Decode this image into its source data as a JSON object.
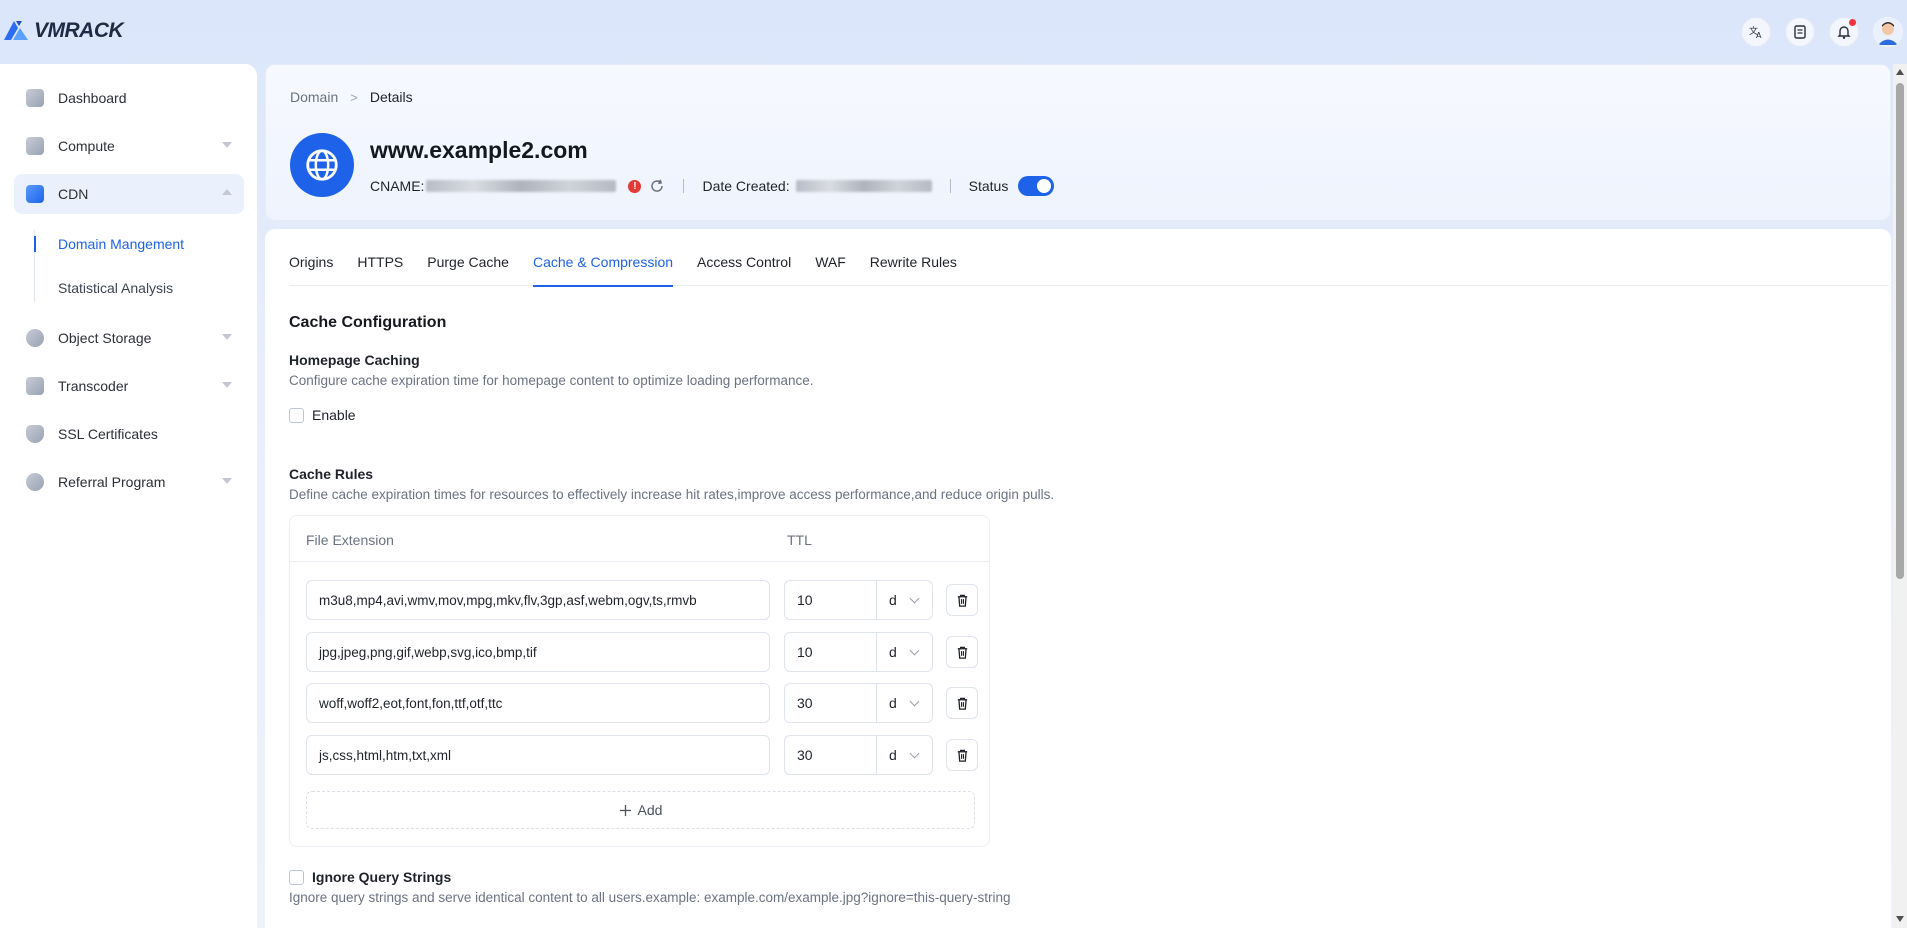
{
  "app": {
    "logo_text": "VMRACK"
  },
  "topbar": {
    "icons": [
      "translate-icon",
      "document-icon",
      "bell-icon",
      "avatar"
    ]
  },
  "sidebar": {
    "items": [
      {
        "label": "Dashboard",
        "icon": "dashboard-icon"
      },
      {
        "label": "Compute",
        "icon": "compute-icon"
      },
      {
        "label": "CDN",
        "icon": "cdn-icon",
        "expanded": true
      },
      {
        "label": "Object Storage",
        "icon": "object-storage-icon"
      },
      {
        "label": "Transcoder",
        "icon": "transcoder-icon"
      },
      {
        "label": "SSL Certificates",
        "icon": "ssl-icon"
      },
      {
        "label": "Referral Program",
        "icon": "referral-icon"
      }
    ],
    "cdn_sub": [
      {
        "label": "Domain Mangement",
        "active": true
      },
      {
        "label": "Statistical Analysis"
      }
    ]
  },
  "header": {
    "breadcrumb": {
      "parent": "Domain",
      "sep": ">",
      "current": "Details"
    },
    "domain": "www.example2.com",
    "cname_label": "CNAME:",
    "warn": "!",
    "date_label": "Date Created:",
    "status_label": "Status",
    "status_on": true
  },
  "tabs": [
    "Origins",
    "HTTPS",
    "Purge Cache",
    "Cache & Compression",
    "Access Control",
    "WAF",
    "Rewrite Rules"
  ],
  "active_tab": "Cache & Compression",
  "cache": {
    "section_title": "Cache Configuration",
    "homepage_title": "Homepage Caching",
    "homepage_desc": "Configure cache expiration time for homepage content to optimize loading performance.",
    "enable_label": "Enable",
    "rules_title": "Cache Rules",
    "rules_desc": "Define cache expiration times for resources to effectively increase hit rates,improve access performance,and reduce origin pulls.",
    "col_ext": "File Extension",
    "col_ttl": "TTL",
    "rules": [
      {
        "ext": "m3u8,mp4,avi,wmv,mov,mpg,mkv,flv,3gp,asf,webm,ogv,ts,rmvb",
        "ttl": "10",
        "unit": "d"
      },
      {
        "ext": "jpg,jpeg,png,gif,webp,svg,ico,bmp,tif",
        "ttl": "10",
        "unit": "d"
      },
      {
        "ext": "woff,woff2,eot,font,fon,ttf,otf,ttc",
        "ttl": "30",
        "unit": "d"
      },
      {
        "ext": "js,css,html,htm,txt,xml",
        "ttl": "30",
        "unit": "d"
      }
    ],
    "add_label": "Add",
    "ignore_qs_label": "Ignore Query Strings",
    "ignore_qs_desc": "Ignore query strings and serve identical content to all users.example: example.com/example.jpg?ignore=this-query-string"
  },
  "colors": {
    "accent": "#1d62e8",
    "danger": "#e53935"
  }
}
